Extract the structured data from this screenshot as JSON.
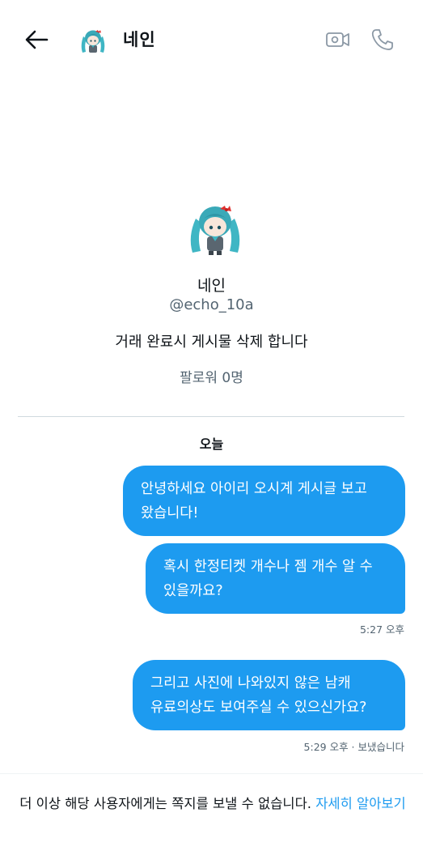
{
  "header": {
    "name": "네인",
    "back_icon": "arrow-left-icon",
    "video_icon": "video-camera-icon",
    "call_icon": "phone-icon"
  },
  "profile": {
    "name": "네인",
    "handle": "@echo_10a",
    "bio": "거래 완료시 게시물 삭제 합니다",
    "followers": "팔로워 0명"
  },
  "conversation": {
    "date_label": "오늘",
    "messages": [
      {
        "text": "안녕하세요 아이리 오시계 게시글 보고\n왔습니다!"
      },
      {
        "text": "혹시 한정티켓 개수나 젬 개수 알 수\n있을까요?"
      },
      {
        "text": "그리고 사진에 나와있지 않은 남캐\n유료의상도 보여주실 수 있으신가요?"
      }
    ],
    "meta": [
      {
        "text": "5:27 오후"
      },
      {
        "text": "5:29 오후 · 보냈습니다"
      }
    ]
  },
  "footer": {
    "notice": "더 이상 해당 사용자에게는 쪽지를 보낼 수 없습니다. ",
    "learn_more": "자세히 알아보기"
  },
  "colors": {
    "accent": "#1d9bf0",
    "text_primary": "#0f1419",
    "text_secondary": "#536471",
    "divider": "#cfd9de"
  }
}
